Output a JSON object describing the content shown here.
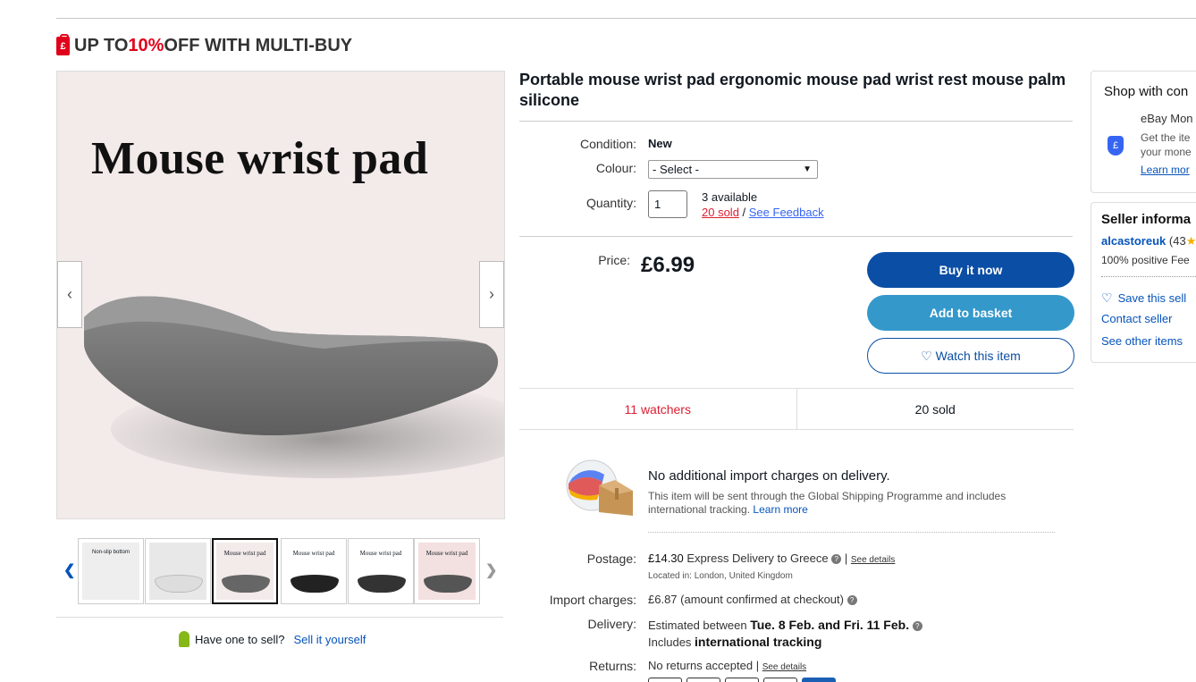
{
  "promo": {
    "text_a": "UP TO ",
    "pct": "10%",
    "text_b": " OFF WITH MULTI-BUY",
    "icon": "price-tag-icon"
  },
  "gallery": {
    "main_image_title": "Mouse wrist pad",
    "thumbnails": [
      {
        "caption": "Non-slip bottom"
      },
      {
        "caption": ""
      },
      {
        "caption": "Mouse wrist pad"
      },
      {
        "caption": "Mouse wrist pad"
      },
      {
        "caption": "Mouse wrist pad"
      },
      {
        "caption": "Mouse wrist pad"
      }
    ],
    "prev_glyph": "‹",
    "next_glyph": "›"
  },
  "sell": {
    "question": "Have one to sell?",
    "link": "Sell it yourself"
  },
  "listing": {
    "title": "Portable mouse wrist pad ergonomic mouse pad wrist rest mouse palm silicone",
    "condition_label": "Condition:",
    "condition_value": "New",
    "colour_label": "Colour:",
    "colour_value": "- Select -",
    "quantity_label": "Quantity:",
    "quantity_value": "1",
    "available": "3 available",
    "sold_link": "20 sold",
    "sep": " / ",
    "feedback_link": "See Feedback",
    "price_label": "Price:",
    "price": "£6.99",
    "buy_now": "Buy it now",
    "add_basket": "Add to basket",
    "watch": "♡ Watch this item",
    "watchers": "11 watchers",
    "sold_count": "20 sold"
  },
  "shipping": {
    "headline": "No additional import charges on delivery.",
    "sub": "This item will be sent through the Global Shipping Programme and includes international tracking.",
    "learn_more": "Learn more",
    "postage_label": "Postage:",
    "postage_price": "£14.30",
    "postage_service": "Express Delivery to Greece",
    "see_details": "See details",
    "located": "Located in:  London, United Kingdom",
    "import_label": "Import charges:",
    "import_price": "£6.87",
    "import_note": "(amount confirmed at checkout)",
    "delivery_label": "Delivery:",
    "delivery_pre": "Estimated between ",
    "delivery_dates": "Tue. 8 Feb. and Fri. 11 Feb.",
    "delivery_includes": "Includes ",
    "delivery_tracking": "international tracking",
    "returns_label": "Returns:",
    "returns_value": "No returns accepted",
    "returns_details": "See details"
  },
  "right": {
    "shop_heading": "Shop with con",
    "money_back_title": "eBay Mon",
    "money_back_line1": "Get the ite",
    "money_back_line2": "your mone",
    "money_back_link": "Learn mor",
    "seller_heading": "Seller informa",
    "seller_name": "alcastoreuk",
    "seller_score": "(43",
    "seller_feedback": "100% positive Fee",
    "save_seller": "Save this sell",
    "contact_seller": "Contact seller",
    "other_items": "See other items"
  },
  "colors": {
    "accent_red": "#e0001b",
    "buy_blue": "#0b4ea5",
    "basket_blue": "#3498ca",
    "link_blue": "#0654ba"
  }
}
